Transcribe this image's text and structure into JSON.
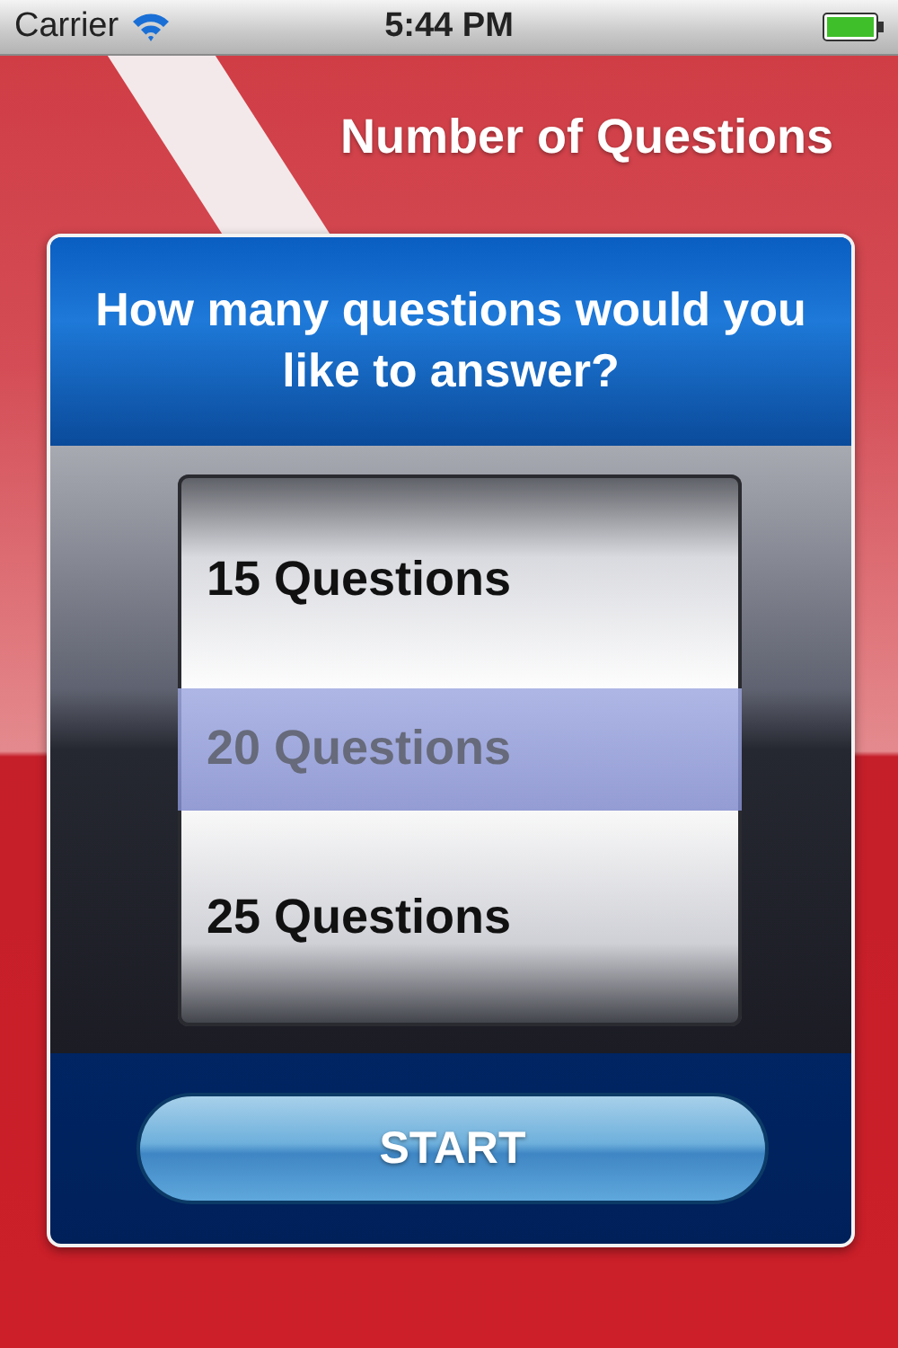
{
  "status_bar": {
    "carrier": "Carrier",
    "time": "5:44 PM"
  },
  "title": "Number of Questions",
  "prompt": "How many questions would you like to answer?",
  "picker": [
    {
      "label": "15 Questions",
      "selected": false
    },
    {
      "label": "20 Questions",
      "selected": true
    },
    {
      "label": "25 Questions",
      "selected": false
    }
  ],
  "start_button": "START"
}
